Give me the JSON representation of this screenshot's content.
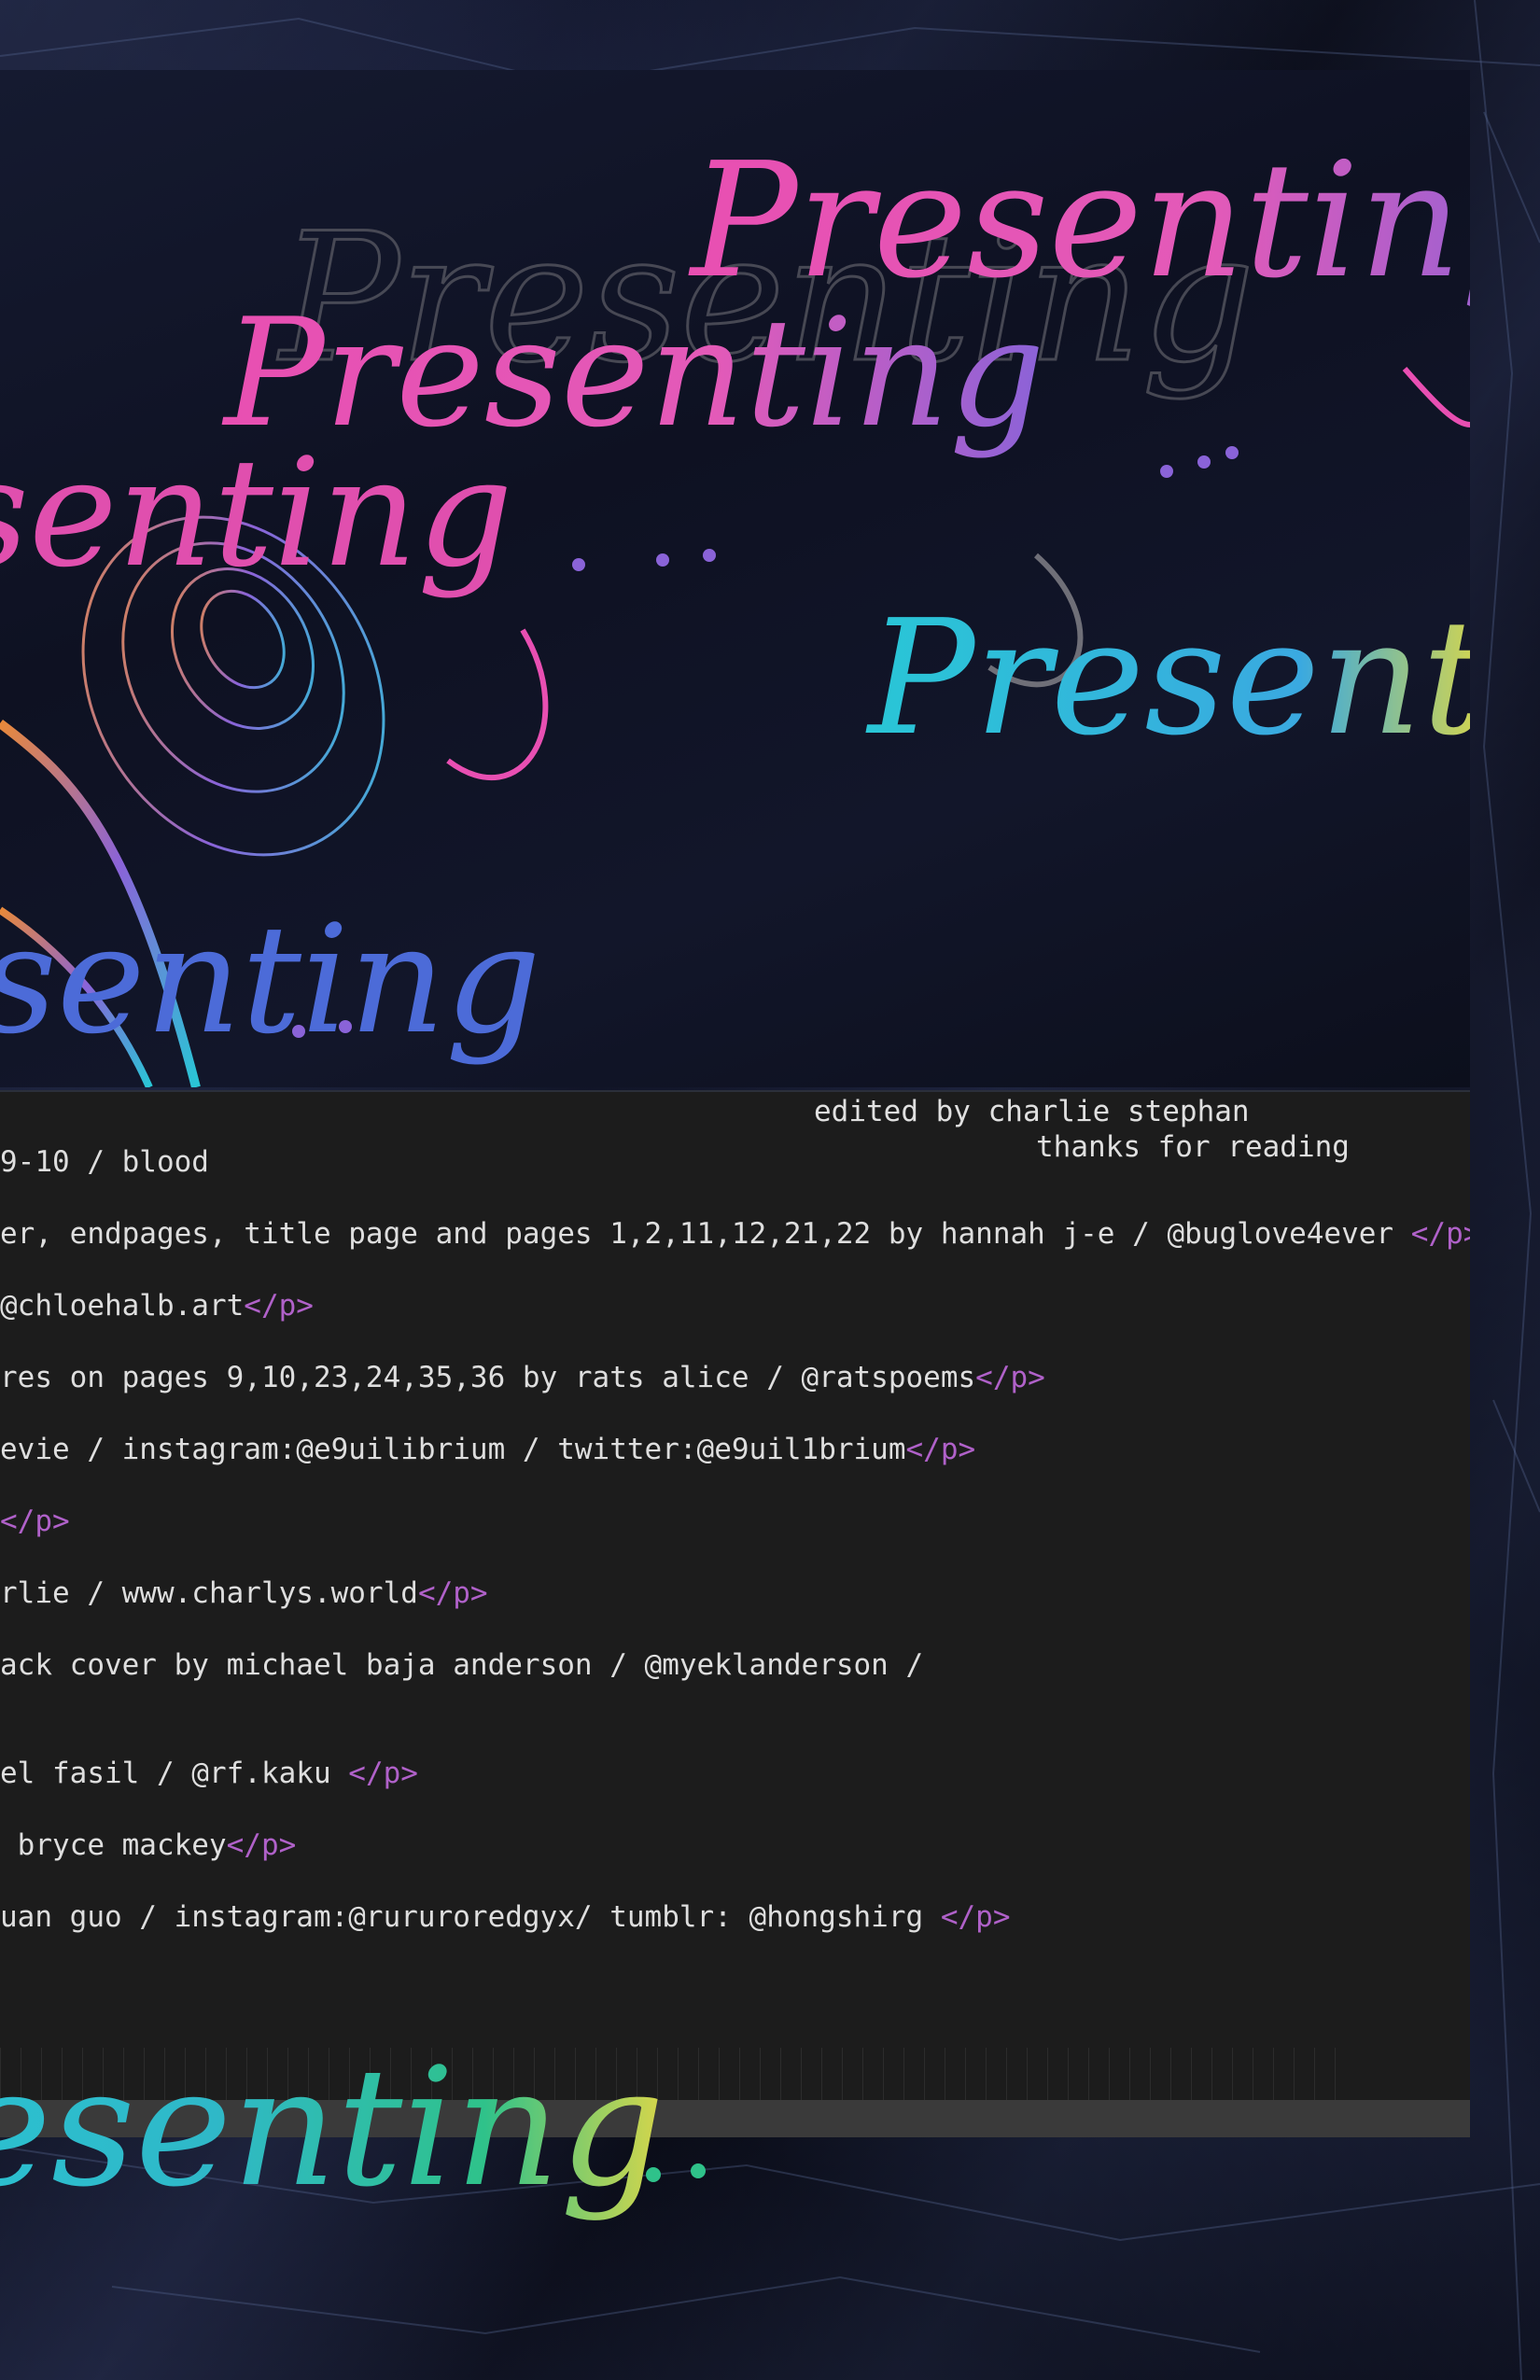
{
  "artwork": {
    "title_word": "Presenting",
    "title_dots": ". . .",
    "colors": {
      "pink": "#e84fb2",
      "cyan": "#29c6d6",
      "purple": "#8a63d8",
      "yellow": "#d8d64a",
      "orange": "#e8893a",
      "grey": "#6f6f78"
    }
  },
  "editor": {
    "lines": [
      {
        "text": "9-10 / blood",
        "close": ""
      },
      {
        "text": "er, endpages, title page and pages 1,2,11,12,21,22 by hannah j-e / @buglove4ever ",
        "close": "</p>"
      },
      {
        "text": "@chloehalb.art",
        "close": "</p>"
      },
      {
        "text": "res on pages 9,10,23,24,35,36 by rats alice / @ratspoems",
        "close": "</p>"
      },
      {
        "text": "evie / instagram:@e9uilibrium / twitter:@e9uil1brium",
        "close": "</p>"
      },
      {
        "text": "",
        "close": "</p>"
      },
      {
        "text": "rlie / www.charlys.world",
        "close": "</p>"
      },
      {
        "text": "ack cover by michael baja anderson / @myeklanderson /",
        "close": ""
      },
      {
        "text": "el fasil / @rf.kaku ",
        "close": "</p>"
      },
      {
        "text": " bryce mackey",
        "close": "</p>"
      },
      {
        "text": "uan guo / instagram:@rururoredgyx/ tumblr: @hongshirg ",
        "close": "</p>"
      }
    ],
    "edited_by": "edited by charlie stephan",
    "thanks": "thanks for reading"
  }
}
